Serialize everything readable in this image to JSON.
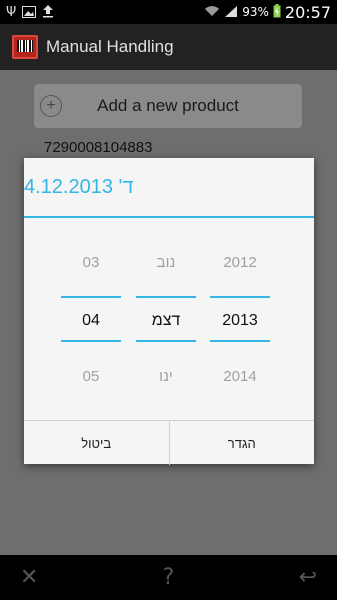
{
  "status_bar": {
    "battery_percent": "93%",
    "time": "20:57",
    "icons": [
      "usb-icon",
      "image-icon",
      "upload-icon",
      "wifi-icon",
      "signal-icon",
      "battery-charging-icon"
    ]
  },
  "action_bar": {
    "title": "Manual Handling",
    "icon": "barcode-app-icon"
  },
  "main": {
    "add_product_label": "Add a new product",
    "barcode_value": "7290008104883"
  },
  "dialog": {
    "title": "ד' 4.12.2013",
    "day_column": {
      "prev": "03",
      "selected": "04",
      "next": "05"
    },
    "month_column": {
      "prev": "נוב",
      "selected": "דצמ",
      "next": "ינו"
    },
    "year_column": {
      "prev": "2012",
      "selected": "2013",
      "next": "2014"
    },
    "cancel_label": "ביטול",
    "set_label": "הגדר",
    "accent_color": "#33b5e5"
  },
  "nav_bar": {
    "icons": [
      "close-icon",
      "help-icon",
      "back-icon"
    ],
    "close_glyph": "✕",
    "help_glyph": "?",
    "back_glyph": "↩"
  }
}
